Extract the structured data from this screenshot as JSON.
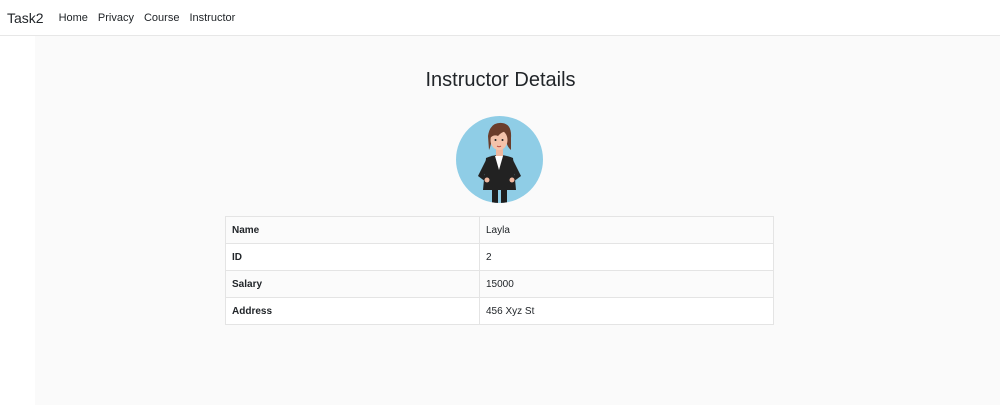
{
  "nav": {
    "brand": "Task2",
    "links": [
      "Home",
      "Privacy",
      "Course",
      "Instructor"
    ]
  },
  "page": {
    "title": "Instructor Details",
    "avatar_icon": "woman-avatar-icon"
  },
  "details": [
    {
      "label": "Name",
      "value": "Layla"
    },
    {
      "label": "ID",
      "value": "2"
    },
    {
      "label": "Salary",
      "value": "15000"
    },
    {
      "label": "Address",
      "value": "456 Xyz St"
    }
  ]
}
